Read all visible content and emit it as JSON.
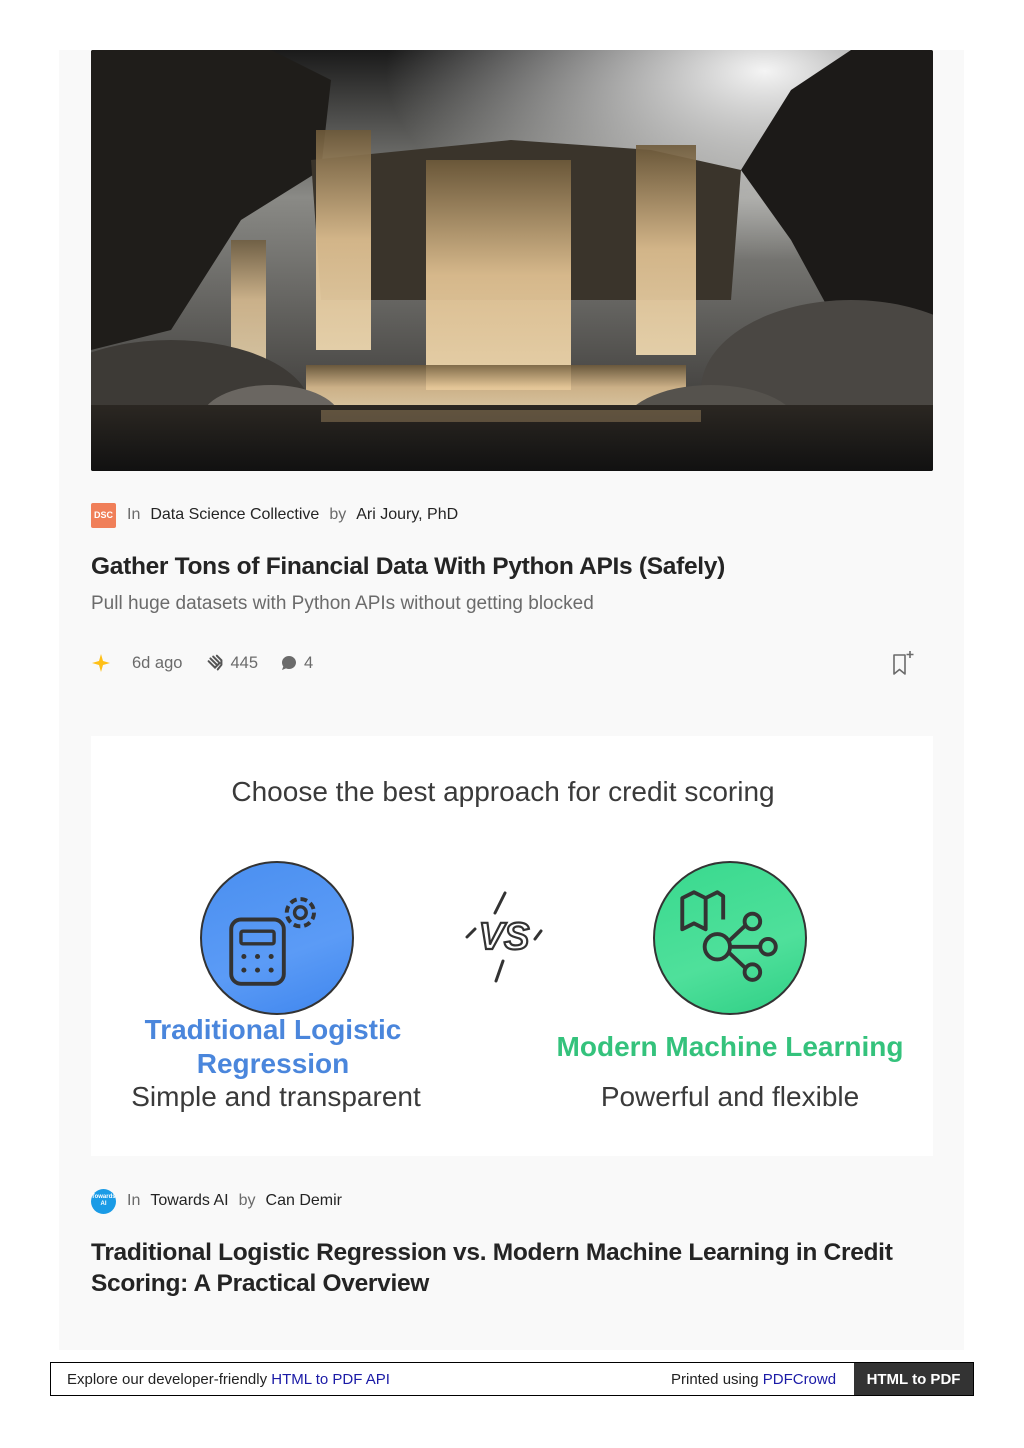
{
  "article1": {
    "publication_logo": "DSC",
    "byline_in": "In",
    "publication": "Data Science Collective",
    "byline_by": "by",
    "author": "Ari Joury, PhD",
    "title": "Gather Tons of Financial Data With Python APIs (Safely)",
    "subtitle": "Pull huge datasets with Python APIs without getting blocked",
    "age": "6d ago",
    "claps": "445",
    "comments": "4",
    "icons": [
      "star-icon",
      "clap-icon",
      "comment-icon",
      "bookmark-add-icon"
    ],
    "star_color": "#ffc017"
  },
  "article2": {
    "graphic": {
      "heading": "Choose the best approach for credit scoring",
      "left_title": "Traditional Logistic Regression",
      "left_desc": "Simple and transparent",
      "right_title": "Modern Machine Learning",
      "right_desc": "Powerful and flexible",
      "left_color": "#4a86dc",
      "right_color": "#34c27c"
    },
    "publication_logo": "Towards AI",
    "byline_in": "In",
    "publication": "Towards AI",
    "byline_by": "by",
    "author": "Can Demir",
    "title": "Traditional Logistic Regression vs. Modern Machine Learning in Credit Scoring: A Practical Overview"
  },
  "footer": {
    "left_text": "Explore our developer-friendly ",
    "left_link": "HTML to PDF API",
    "mid_text": "Printed using ",
    "mid_link": "PDFCrowd",
    "cta": "HTML to PDF"
  }
}
